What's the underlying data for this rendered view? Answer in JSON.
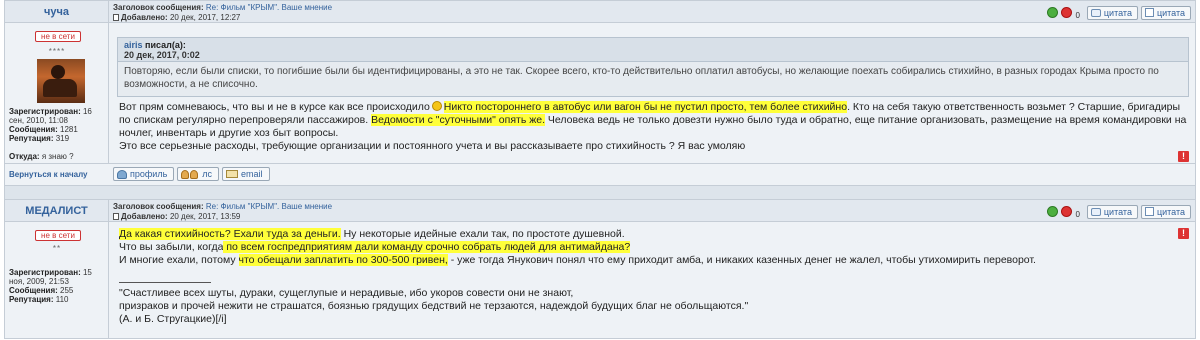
{
  "posts": [
    {
      "author": "чуча",
      "subject_label": "Заголовок сообщения:",
      "subject": "Re: Фильм \"КРЫМ\". Ваше мнение",
      "added_label": "Добавлено:",
      "added": "20 дек, 2017, 12:27",
      "rep_count": "0",
      "quote_label": "цитата",
      "quote_label2": "цитата",
      "status": "не в сети",
      "stars": "****",
      "registered_label": "Зарегистрирован:",
      "registered": "16 сен, 2010, 11:08",
      "messages_label": "Сообщения:",
      "messages": "1281",
      "reputation_label": "Репутация:",
      "reputation": "319",
      "from_label": "Откуда:",
      "from": "я знаю ?",
      "quote": {
        "author": "airis",
        "wrote": "писал(а):",
        "date": "20 дек, 2017, 0:02",
        "text": "Повторяю, если были списки, то погибшие были бы идентифицированы, а это не так. Скорее всего, кто-то действительно оплатил автобусы, но желающие поехать собирались стихийно, в разных городах Крыма просто по возможности, а не списочно."
      },
      "body": {
        "p1_a": "Вот прям сомневаюсь, что вы и не в курсе как все происходило",
        "p1_hl": "Никто постороннего в автобус или вагон бы не пустил просто, тем более стихийно",
        "p1_b": ". Кто на себя такую ответственность возьмет ? Старшие, бригадиры по спискам регулярно",
        "p2_a": "перепроверяли пассажиров.",
        "p2_hl": "Ведомости с \"суточными\" опять же.",
        "p2_b": " Человека ведь не только довезти нужно было туда и обратно, еще питание организовать, размещение на время командировки на ночлег, инвентарь и другие хоз быт вопросы.",
        "p3": "Это все серьезные расходы, требующие организации и постоянного учета и вы рассказываете про стихийность ? Я вас умоляю"
      },
      "footer": {
        "back": "Вернуться к началу",
        "profile": "профиль",
        "pm": "лс",
        "email": "email"
      },
      "report": "!"
    },
    {
      "author": "МЕДАЛИСТ",
      "subject_label": "Заголовок сообщения:",
      "subject": "Re: Фильм \"КРЫМ\". Ваше мнение",
      "added_label": "Добавлено:",
      "added": "20 дек, 2017, 13:59",
      "rep_count": "0",
      "quote_label": "цитата",
      "quote_label2": "цитата",
      "status": "не в сети",
      "stars": "**",
      "registered_label": "Зарегистрирован:",
      "registered": "15 ноя, 2009, 21:53",
      "messages_label": "Сообщения:",
      "messages": "255",
      "reputation_label": "Репутация:",
      "reputation": "110",
      "body": {
        "l1_hl": "Да какая стихийность? Ехали туда за деньги.",
        "l1_b": " Ну некоторые идейные ехали так, по простоте душевной.",
        "l2_a": "Что вы забыли, когда",
        "l2_hl": " по всем госпредприятиям дали команду срочно собрать людей для антимайдана?",
        "l3_a": "И многие ехали, потому ",
        "l3_hl": "что обещали заплатить по 300-500 гривен,",
        "l3_b": " - уже тогда Янукович понял что ему приходит амба, и никаких казенных денег не жалел, чтобы утихомирить переворот.",
        "sig1": "\"Счастливее всех шуты, дураки, сущеглупые и нерадивые, ибо укоров совести они не знают,",
        "sig2": "призраков и прочей нежити не страшатся, боязнью грядущих бедствий не терзаются, надеждой будущих благ не обольщаются.\"",
        "sig3": "(А. и Б. Стругацкие)[/i]"
      },
      "report": "!"
    }
  ]
}
